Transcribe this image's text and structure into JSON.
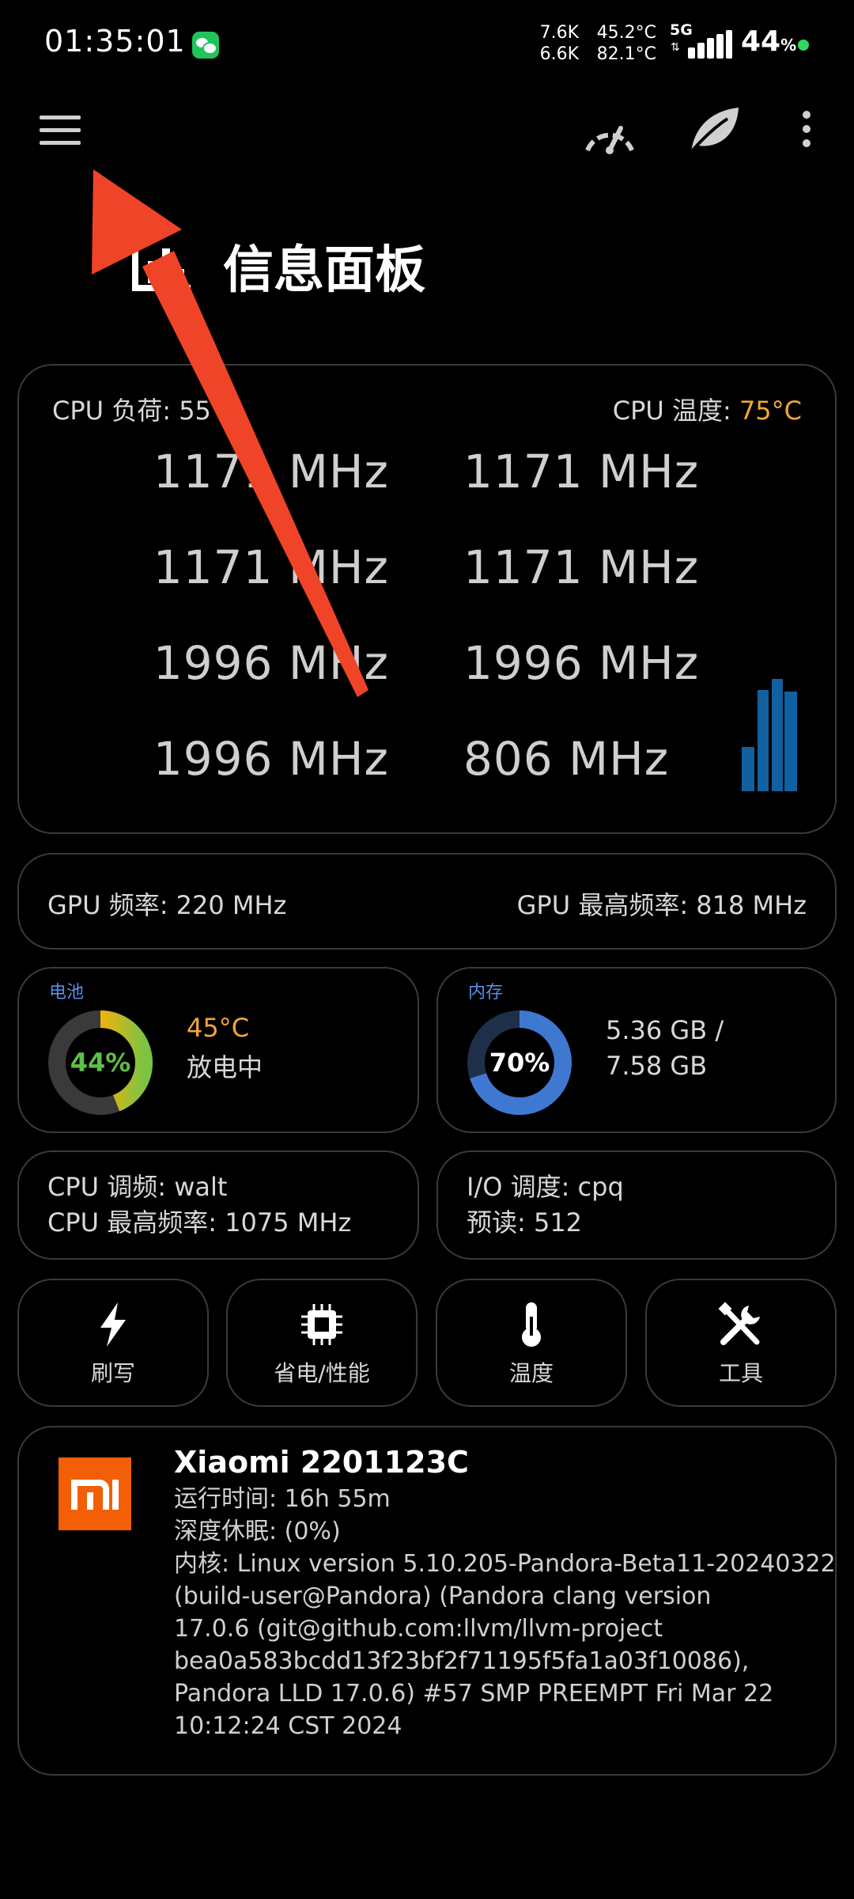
{
  "status_bar": {
    "time": "01:35:01",
    "net_up": "7.6K",
    "net_down": "6.6K",
    "temp1": "45.2°C",
    "temp2": "82.1°C",
    "network": "5G",
    "battery_percent": "44",
    "battery_unit": "%"
  },
  "app_bar": {
    "menu_icon": "hamburger-menu-icon",
    "icons": [
      "speedometer-icon",
      "leaf-icon",
      "more-vert-icon"
    ]
  },
  "page": {
    "title": "信息面板"
  },
  "cpu": {
    "load_label": "CPU 负荷: 55",
    "temp_label": "CPU 温度: ",
    "temp_value": "75°C",
    "freqs_left": [
      "1171 MHz",
      "1171 MHz",
      "1996 MHz",
      "1996 MHz"
    ],
    "freqs_right": [
      "1171 MHz",
      "1171 MHz",
      "1996 MHz",
      "806 MHz"
    ],
    "chart_color": "#1565a8"
  },
  "gpu": {
    "freq": "GPU 频率: 220 MHz",
    "max_freq": "GPU 最高频率: 818 MHz"
  },
  "battery": {
    "label": "电池",
    "percent": "44%",
    "level": 0.44,
    "temp": "45°C",
    "state": "放电中"
  },
  "memory": {
    "label": "内存",
    "percent": "70%",
    "level": 0.7,
    "used": "5.36 GB /",
    "total": "7.58 GB"
  },
  "governor": {
    "line1": "CPU 调频: walt",
    "line2": "CPU 最高频率: 1075 MHz"
  },
  "io": {
    "line1": "I/O 调度: cpq",
    "line2": "预读: 512"
  },
  "tiles": [
    {
      "label": "刷写",
      "icon": "lightning-icon"
    },
    {
      "label": "省电/性能",
      "icon": "chip-icon"
    },
    {
      "label": "温度",
      "icon": "thermometer-icon"
    },
    {
      "label": "工具",
      "icon": "tools-icon"
    }
  ],
  "device": {
    "name": "Xiaomi 2201123C",
    "uptime": "运行时间: 16h 55m",
    "deep_sleep": "深度休眠: (0%)",
    "kernel_lines": [
      "内核: Linux version 5.10.205-Pandora-Beta11-20240322",
      "(build-user@Pandora) (Pandora clang version",
      "17.0.6 (git@github.com:llvm/llvm-project",
      "bea0a583bcdd13f23bf2f71195f5fa1a03f10086),",
      "Pandora LLD 17.0.6) #57 SMP PREEMPT Fri Mar 22",
      "10:12:24 CST 2024"
    ]
  }
}
